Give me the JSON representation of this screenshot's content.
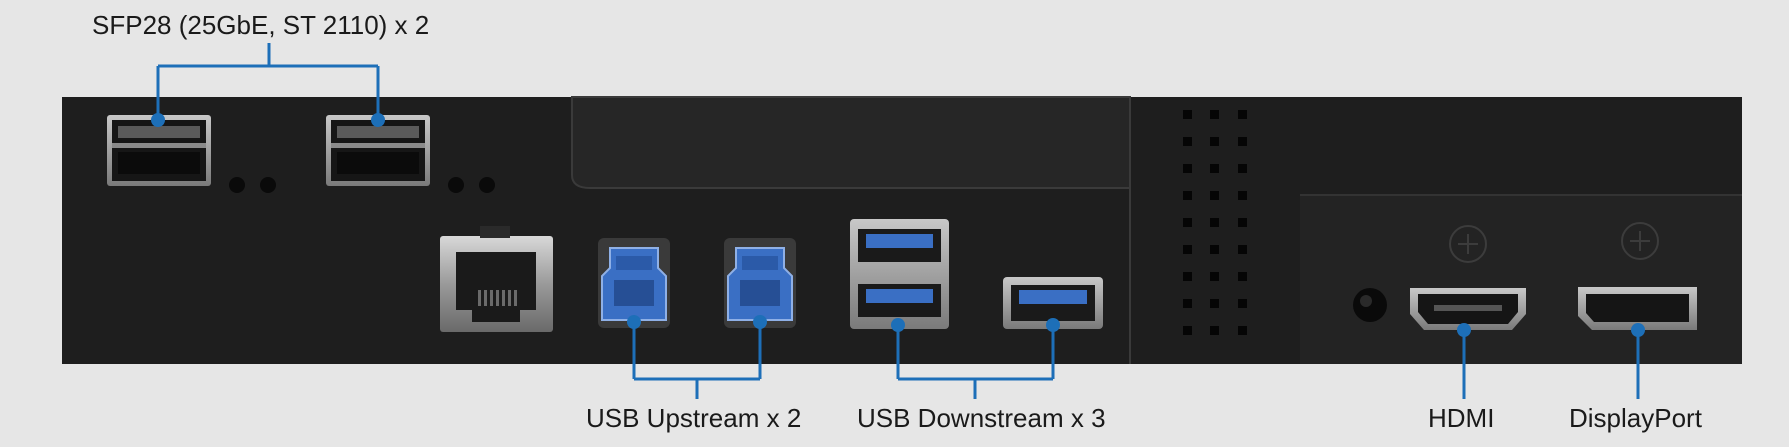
{
  "labels": {
    "sfp": "SFP28 (25GbE, ST 2110) x 2",
    "usb_up": "USB Upstream x 2",
    "usb_down": "USB Downstream x 3",
    "hdmi": "HDMI",
    "dp": "DisplayPort"
  },
  "colors": {
    "background": "#e6e6e6",
    "panel": "#1e1e1e",
    "callout": "#1d6fb8",
    "usb_blue": "#3a6fc4",
    "text": "#1a1a1a"
  }
}
